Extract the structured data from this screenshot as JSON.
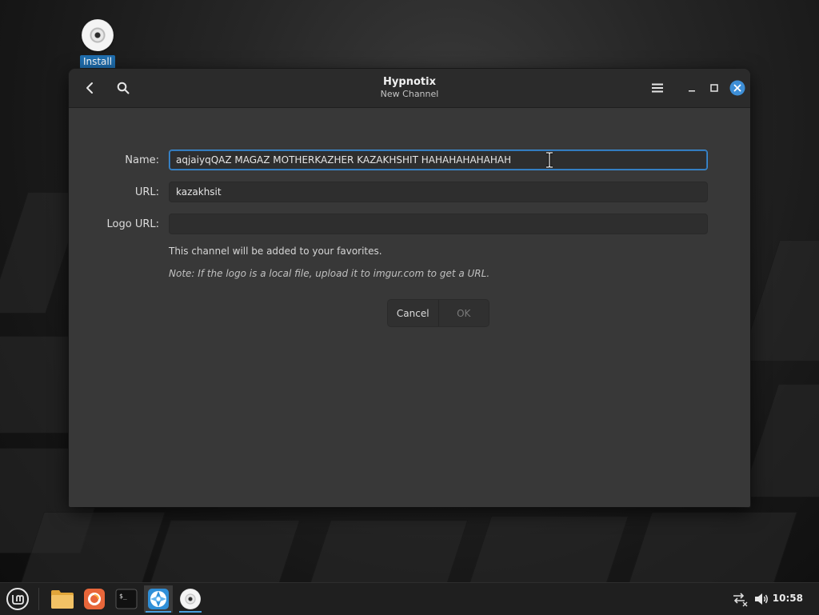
{
  "desktop": {
    "icons": [
      {
        "label": "Install",
        "icon": "disc-icon"
      }
    ]
  },
  "window": {
    "title": "Hypnotix",
    "subtitle": "New Channel",
    "controls": {
      "back": "back-arrow-icon",
      "search": "search-icon",
      "menu": "hamburger-menu-icon",
      "minimize": "minimize-icon",
      "maximize": "maximize-icon",
      "close": "close-icon"
    },
    "accent_color": "#3d8ed6"
  },
  "form": {
    "name_label": "Name:",
    "name_value": "aqjaiyqQAZ MAGAZ MOTHERKAZHER KAZAKHSHIT HAHAHAHAHAHAH",
    "url_label": "URL:",
    "url_value": "kazakhsit",
    "logo_label": "Logo URL:",
    "logo_value": "",
    "favorites_note": "This channel will be added to your favorites.",
    "logo_note": "Note: If the logo is a local file, upload it to imgur.com to get a URL.",
    "cancel_label": "Cancel",
    "ok_label": "OK"
  },
  "taskbar": {
    "items": [
      {
        "icon": "mint-menu-icon"
      },
      {
        "icon": "folder-icon"
      },
      {
        "icon": "firefox-icon"
      },
      {
        "icon": "terminal-icon"
      },
      {
        "icon": "hypnotix-icon"
      },
      {
        "icon": "disc-icon"
      }
    ],
    "tray": [
      {
        "icon": "network-disconnected-icon"
      },
      {
        "icon": "volume-icon"
      }
    ],
    "clock": "10:58"
  }
}
